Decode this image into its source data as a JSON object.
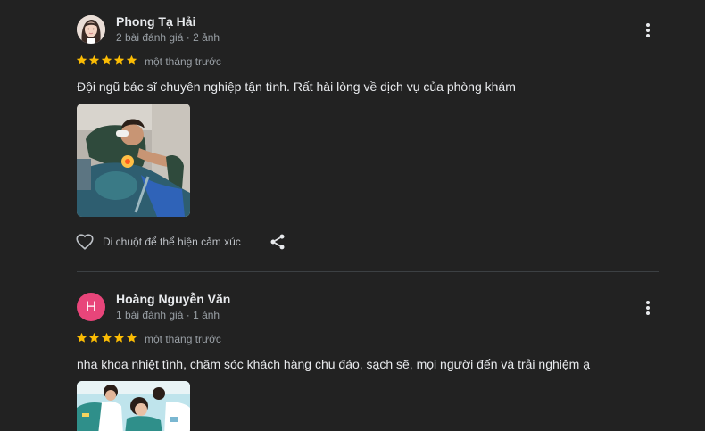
{
  "colors": {
    "background": "#222222",
    "text_primary": "#e8eaed",
    "text_secondary": "#9aa0a6",
    "star": "#fbbc04",
    "avatar_letter_bg": "#e8457a",
    "divider": "#3c4043"
  },
  "reviews": [
    {
      "author": "Phong Tạ Hải",
      "meta": "2 bài đánh giá · 2 ảnh",
      "avatar_type": "photo",
      "rating": 5,
      "time": "một tháng trước",
      "text": "Đội ngũ bác sĩ chuyên nghiệp tận tình. Rất hài lòng về dịch vụ của phòng khám",
      "like_label": "Di chuột để thể hiện cảm xúc",
      "icons": [
        "more-vert-icon",
        "star-icon",
        "heart-outline-icon",
        "share-icon"
      ]
    },
    {
      "author": "Hoàng Nguyễn Văn",
      "meta": "1 bài đánh giá · 1 ảnh",
      "avatar_letter": "H",
      "rating": 5,
      "time": "một tháng trước",
      "text": "nha khoa nhiệt tình, chăm sóc khách hàng chu đáo, sạch sẽ, mọi người đến và trải nghiệm ạ",
      "icons": [
        "more-vert-icon",
        "star-icon"
      ]
    }
  ]
}
